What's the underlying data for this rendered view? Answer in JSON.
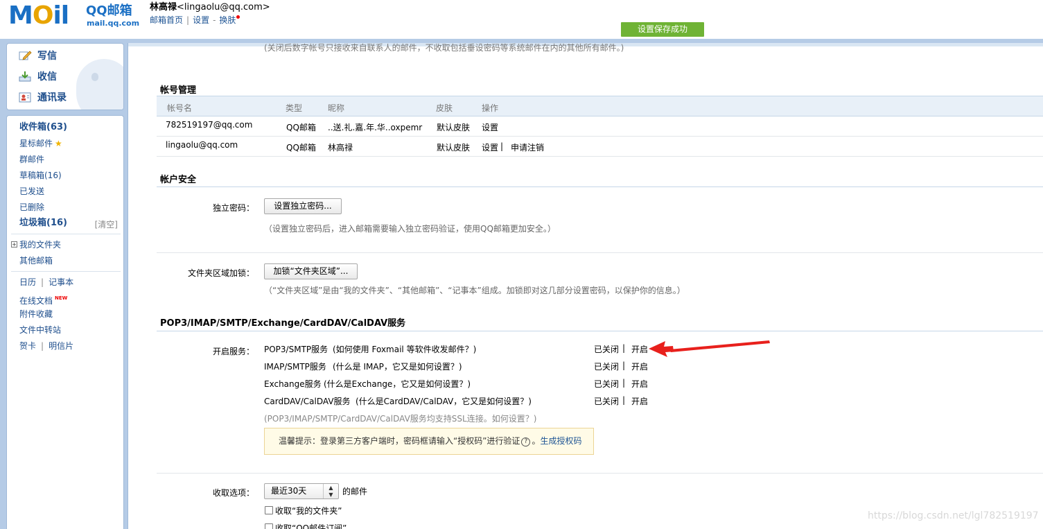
{
  "header": {
    "logo_mail": "MOil",
    "logo_qq": "QQ邮箱",
    "logo_domain": "mail.qq.com",
    "user_name": "林高禄",
    "user_email": "<lingaolu@qq.com>",
    "links": [
      "邮箱首页",
      "设置",
      "换肤"
    ],
    "save_status": "设置保存成功"
  },
  "quick": {
    "write": "写信",
    "receive": "收信",
    "contacts": "通讯录"
  },
  "nav": {
    "inbox": "收件箱(63)",
    "starred": "星标邮件",
    "group": "群邮件",
    "drafts": "草稿箱(16)",
    "sent": "已发送",
    "deleted": "已删除",
    "spam": "垃圾箱(16)",
    "spam_clear": "[清空]",
    "my_folders": "我的文件夹",
    "other_mailboxes": "其他邮箱",
    "calendar": "日历",
    "notes": "记事本",
    "online_docs": "在线文档",
    "new_badge": "NEW",
    "attachments": "附件收藏",
    "transfer": "文件中转站",
    "cards": "贺卡",
    "postcards": "明信片"
  },
  "main": {
    "cut_note": "(关闭后数字帐号只接收来自联系人的邮件，不收取包括垂设密码等系统邮件在内的其他所有邮件。)",
    "account_mgmt": {
      "title": "帐号管理",
      "headers": [
        "帐号名",
        "类型",
        "昵称",
        "皮肤",
        "操作"
      ],
      "rows": [
        {
          "name": "782519197@qq.com",
          "type": "QQ邮箱",
          "nick": "..送.礼.嘉.年.华..oxpemr",
          "skin": "默认皮肤",
          "op": "设置",
          "op2": ""
        },
        {
          "name": "lingaolu@qq.com",
          "type": "QQ邮箱",
          "nick": "林高禄",
          "skin": "默认皮肤",
          "op": "设置",
          "op2": "申请注销"
        }
      ]
    },
    "security": {
      "title": "帐户安全",
      "pwd_label": "独立密码：",
      "pwd_button": "设置独立密码...",
      "pwd_note": "（设置独立密码后，进入邮箱需要输入独立密码验证，使用QQ邮箱更加安全。）",
      "lock_label": "文件夹区域加锁：",
      "lock_button": "加锁“文件夹区域”...",
      "lock_note": "（“文件夹区域”是由“我的文件夹”、“其他邮箱”、“记事本”组成。加锁即对这几部分设置密码，以保护你的信息。）"
    },
    "services": {
      "title": "POP3/IMAP/SMTP/Exchange/CardDAV/CalDAV服务",
      "label": "开启服务：",
      "items": [
        {
          "name": "POP3/SMTP服务",
          "help": "(如何使用 Foxmail 等软件收发邮件？)",
          "status": "已关闭",
          "action": "开启"
        },
        {
          "name": "IMAP/SMTP服务",
          "help": "(什么是 IMAP，它又是如何设置？)",
          "status": "已关闭",
          "action": "开启"
        },
        {
          "name": "Exchange服务",
          "help": "(什么是Exchange，它又是如何设置？)",
          "status": "已关闭",
          "action": "开启"
        },
        {
          "name": "CardDAV/CalDAV服务",
          "help": "(什么是CardDAV/CalDAV，它又是如何设置？)",
          "status": "已关闭",
          "action": "开启"
        }
      ],
      "ssl_note": "(POP3/IMAP/SMTP/CardDAV/CalDAV服务均支持SSL连接。如何设置？)",
      "tip_text": "温馨提示：登录第三方客户端时，密码框请输入“授权码”进行验证",
      "tip_link": "生成授权码"
    },
    "fetch": {
      "label": "收取选项：",
      "select_value": "最近30天",
      "suffix": "的邮件",
      "check1": "收取“我的文件夹”",
      "check2": "收取“QQ邮件订阅”"
    }
  },
  "watermark": "https://blog.csdn.net/lgl782519197",
  "colors": {
    "brand_blue": "#1a6fc4",
    "link_blue": "#1e5494",
    "save_green": "#6fb335",
    "arrow_red": "#e8201c",
    "frame_blue": "#b5cbe6"
  }
}
